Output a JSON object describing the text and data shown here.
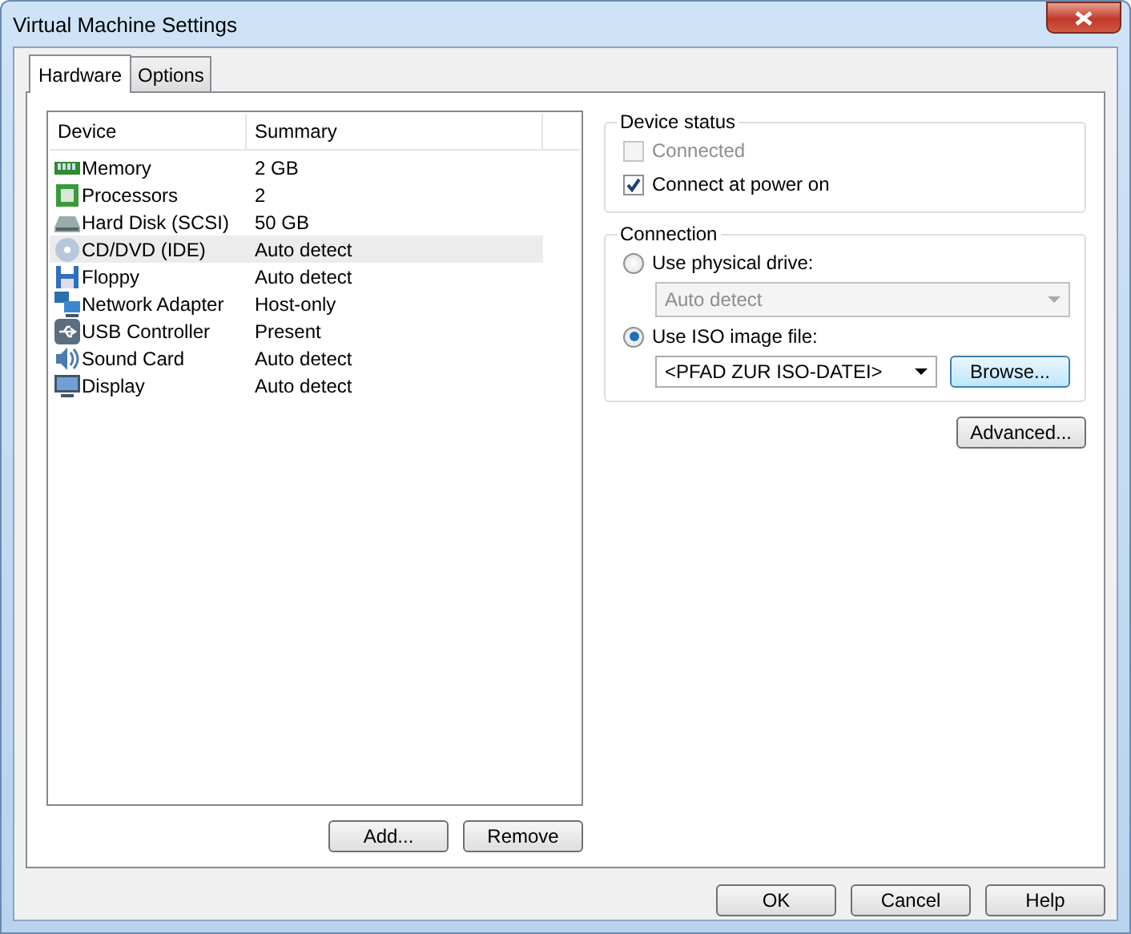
{
  "window": {
    "title": "Virtual Machine Settings"
  },
  "tabs": [
    {
      "label": "Hardware",
      "selected": true
    },
    {
      "label": "Options",
      "selected": false
    }
  ],
  "device_list": {
    "columns": [
      "Device",
      "Summary"
    ],
    "rows": [
      {
        "kind": "memory",
        "device": "Memory",
        "summary": "2 GB",
        "selected": false
      },
      {
        "kind": "processor",
        "device": "Processors",
        "summary": "2",
        "selected": false
      },
      {
        "kind": "disk",
        "device": "Hard Disk (SCSI)",
        "summary": "50 GB",
        "selected": false
      },
      {
        "kind": "cd",
        "device": "CD/DVD (IDE)",
        "summary": "Auto detect",
        "selected": true
      },
      {
        "kind": "floppy",
        "device": "Floppy",
        "summary": "Auto detect",
        "selected": false
      },
      {
        "kind": "network",
        "device": "Network Adapter",
        "summary": "Host-only",
        "selected": false
      },
      {
        "kind": "usb",
        "device": "USB Controller",
        "summary": "Present",
        "selected": false
      },
      {
        "kind": "sound",
        "device": "Sound Card",
        "summary": "Auto detect",
        "selected": false
      },
      {
        "kind": "display",
        "device": "Display",
        "summary": "Auto detect",
        "selected": false
      }
    ],
    "buttons": [
      "Add...",
      "Remove"
    ]
  },
  "device_status": {
    "title": "Device status",
    "options": [
      {
        "label": "Connected",
        "checked": false,
        "disabled": true
      },
      {
        "label": "Connect at power on",
        "checked": true,
        "disabled": false
      }
    ]
  },
  "connection": {
    "title": "Connection",
    "physical": {
      "label": "Use physical drive:",
      "selected": false,
      "drive": "Auto detect",
      "disabled": true
    },
    "iso": {
      "label": "Use ISO image file:",
      "selected": true,
      "path": "<PFAD ZUR ISO-DATEI>",
      "browse": "Browse..."
    }
  },
  "advanced_button": "Advanced...",
  "footer_buttons": [
    "OK",
    "Cancel",
    "Help"
  ]
}
